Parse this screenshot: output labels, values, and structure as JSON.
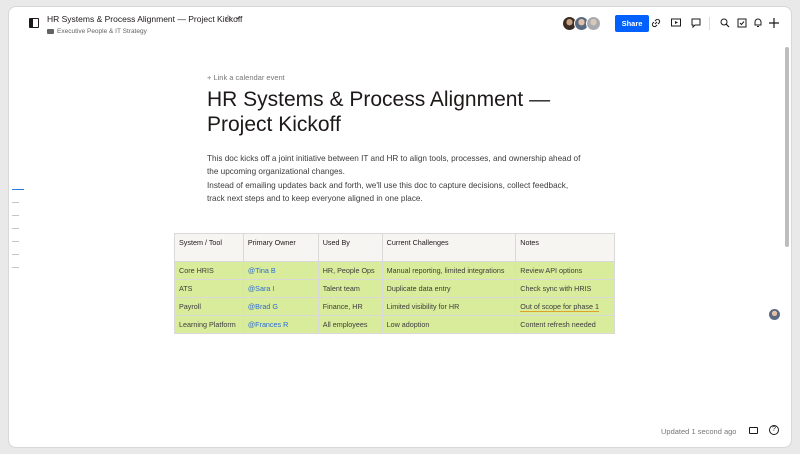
{
  "header": {
    "title": "HR Systems & Process Alignment — Project Kickoff",
    "star_glyph": "☆",
    "chevron_glyph": "⌄",
    "breadcrumb": "Executive People & IT Strategy",
    "share_label": "Share",
    "icons": [
      "link-icon",
      "present-icon",
      "search-icon",
      "task-icon",
      "bell-icon",
      "plus-icon"
    ]
  },
  "document": {
    "link_calendar": "+ Link a calendar event",
    "title": "HR Systems & Process Alignment — Project Kickoff",
    "paragraph1": "This doc kicks off a joint initiative between IT and HR to align tools, processes, and ownership ahead of the upcoming organizational changes.",
    "paragraph2": "Instead of emailing updates back and forth, we'll use this doc to capture decisions, collect feedback, track next steps and to keep everyone aligned in one place."
  },
  "table": {
    "headers": [
      "System / Tool",
      "Primary Owner",
      "Used By",
      "Current Challenges",
      "Notes"
    ],
    "rows": [
      [
        "Core HRIS",
        "@Tina B",
        "HR, People Ops",
        "Manual reporting, limited integrations",
        "Review API options"
      ],
      [
        "ATS",
        "@Sara I",
        "Talent team",
        "Duplicate data entry",
        "Check sync with HRIS"
      ],
      [
        "Payroll",
        "@Brad G",
        "Finance, HR",
        "Limited visibility for HR",
        "Out of scope for phase 1"
      ],
      [
        "Learning Platform",
        "@Frances R",
        "All employees",
        "Low adoption",
        "Content refresh needed"
      ]
    ]
  },
  "footer": {
    "updated": "Updated 1 second ago",
    "help_glyph": "?"
  },
  "colors": {
    "accent": "#0061fe",
    "row_highlight": "#d9ec9b",
    "mention": "#2b6cd4"
  }
}
